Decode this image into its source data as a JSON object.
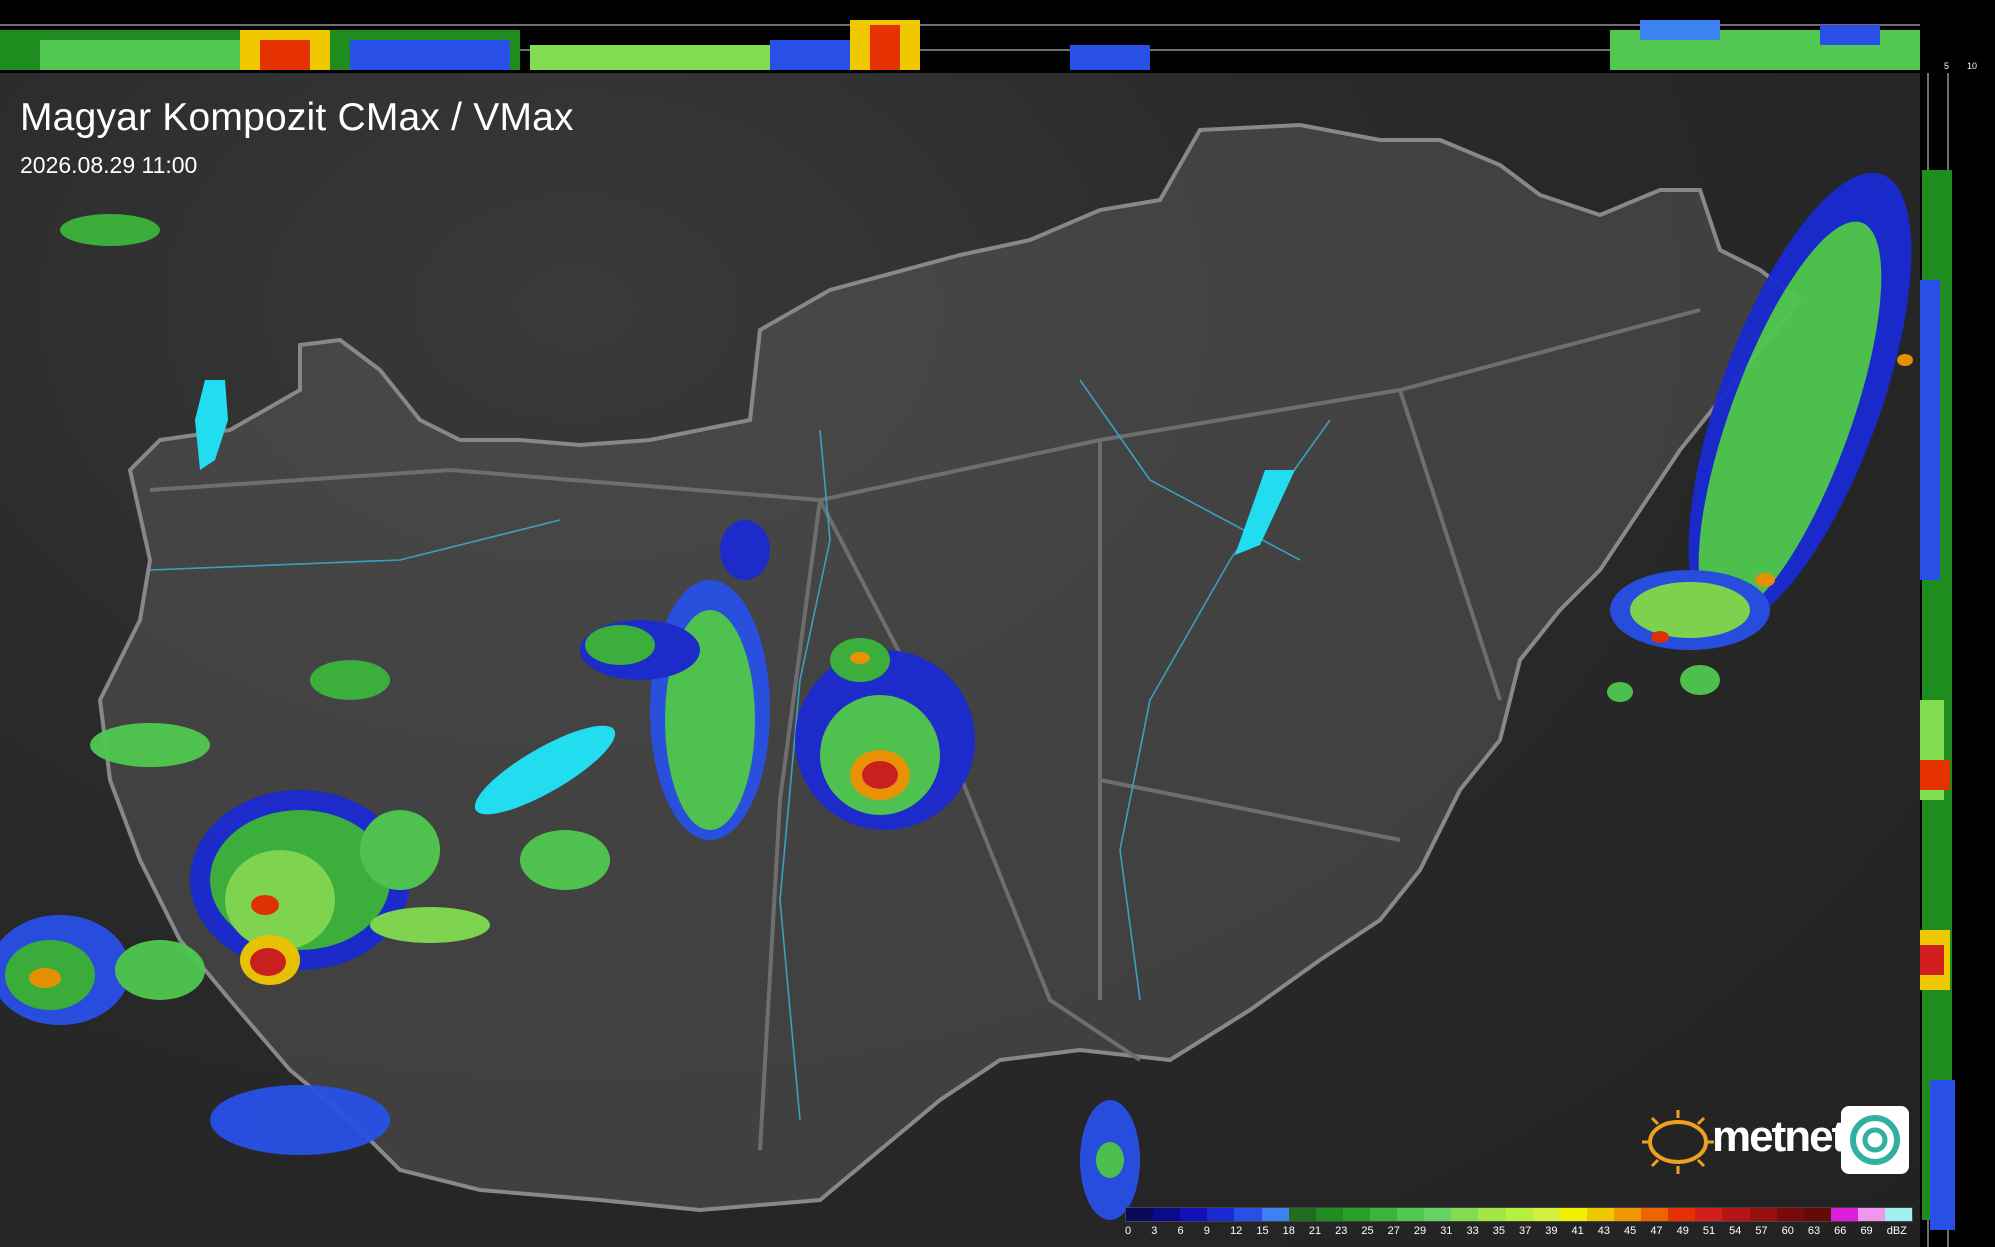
{
  "map": {
    "title": "Magyar Kompozit CMax / VMax",
    "timestamp": "2026.08.29 11:00",
    "brand": "metnet",
    "logo_icons": [
      "sun-icon",
      "swirl-logo-icon"
    ]
  },
  "profile_ticks": {
    "top": [
      "10",
      "5"
    ],
    "right": [
      "5",
      "10"
    ]
  },
  "legend": {
    "unit": "dBZ",
    "labels": [
      "0",
      "3",
      "6",
      "9",
      "12",
      "15",
      "18",
      "21",
      "23",
      "25",
      "27",
      "29",
      "31",
      "33",
      "35",
      "37",
      "39",
      "41",
      "43",
      "45",
      "47",
      "49",
      "51",
      "54",
      "57",
      "60",
      "63",
      "66",
      "69"
    ],
    "colors": [
      "#0a0a5a",
      "#0a0a8c",
      "#1010b4",
      "#1a2ad2",
      "#2850e6",
      "#3c82f0",
      "#1e6e1e",
      "#1e8c1e",
      "#28a028",
      "#3cb43c",
      "#50c850",
      "#64d264",
      "#82dc50",
      "#a0e646",
      "#b4f03c",
      "#d2f03c",
      "#f0f000",
      "#f0c800",
      "#f09600",
      "#f06400",
      "#e63200",
      "#d21e1e",
      "#b41414",
      "#961010",
      "#780a0a",
      "#640808",
      "#dc1edc",
      "#f096f0",
      "#a0f0f0"
    ]
  }
}
